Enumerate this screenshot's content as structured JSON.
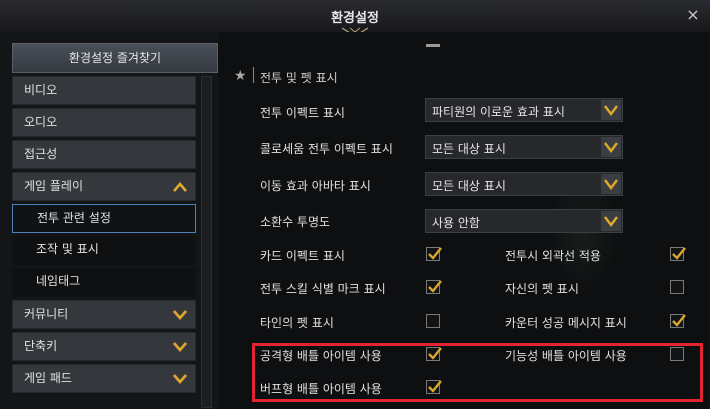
{
  "window": {
    "title": "환경설정",
    "close_icon": "×"
  },
  "sidebar": {
    "favorites_label": "환경설정 즐겨찾기",
    "items": [
      {
        "label": "비디오",
        "type": "category",
        "expandable": false
      },
      {
        "label": "오디오",
        "type": "category",
        "expandable": false
      },
      {
        "label": "접근성",
        "type": "category",
        "expandable": false
      },
      {
        "label": "게임 플레이",
        "type": "category",
        "expandable": true,
        "expanded": true
      },
      {
        "label": "전투 관련 설정",
        "type": "sub",
        "selected": true
      },
      {
        "label": "조작 및 표시",
        "type": "sub"
      },
      {
        "label": "네임태그",
        "type": "sub"
      },
      {
        "label": "커뮤니티",
        "type": "category",
        "expandable": true,
        "expanded": false
      },
      {
        "label": "단축키",
        "type": "category",
        "expandable": true,
        "expanded": false
      },
      {
        "label": "게임 패드",
        "type": "category",
        "expandable": true,
        "expanded": false
      }
    ]
  },
  "section": {
    "icon": "star-icon",
    "title": "전투 및 펫 표시"
  },
  "dropdowns": [
    {
      "label": "전투 이펙트 표시",
      "value": "파티원의 이로운 효과 표시"
    },
    {
      "label": "콜로세움 전투 이펙트 표시",
      "value": "모든 대상 표시"
    },
    {
      "label": "이동 효과 아바타 표시",
      "value": "모든 대상 표시"
    },
    {
      "label": "소환수 투명도",
      "value": "사용 안함"
    }
  ],
  "checkboxes": [
    {
      "label": "카드 이펙트 표시",
      "checked": true
    },
    {
      "label": "전투시 외곽선 적용",
      "checked": true
    },
    {
      "label": "전투 스킬 식별 마크 표시",
      "checked": true
    },
    {
      "label": "자신의 펫 표시",
      "checked": false
    },
    {
      "label": "타인의 펫 표시",
      "checked": false
    },
    {
      "label": "카운터 성공 메시지 표시",
      "checked": true
    },
    {
      "label": "공격형 배틀 아이템 사용",
      "checked": true
    },
    {
      "label": "기능성 배틀 아이템 사용",
      "checked": false
    },
    {
      "label": "버프형 배틀 아이템 사용",
      "checked": true
    }
  ],
  "colors": {
    "accent_check": "#d9a82a",
    "highlight_border": "#e0262e",
    "selected_border": "#4d83b7"
  }
}
